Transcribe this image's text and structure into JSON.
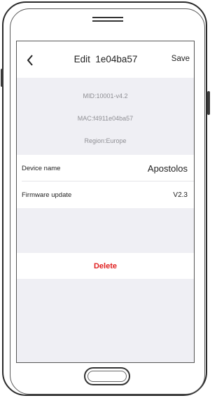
{
  "navbar": {
    "back_icon": "chevron-left-icon",
    "title": "Edit  1e04ba57",
    "save_label": "Save"
  },
  "device_info": {
    "mid": "MID:10001-v4.2",
    "mac": "MAC:f4911e04ba57",
    "region": "Region:Europe"
  },
  "settings": {
    "device_name_label": "Device name",
    "device_name_value": "Apostolos",
    "firmware_label": "Firmware update",
    "firmware_value": "V2.3"
  },
  "actions": {
    "delete_label": "Delete"
  },
  "colors": {
    "background": "#efeff4",
    "surface": "#ffffff",
    "text_primary": "#222222",
    "text_secondary": "#8e8e93",
    "destructive": "#e02020"
  }
}
